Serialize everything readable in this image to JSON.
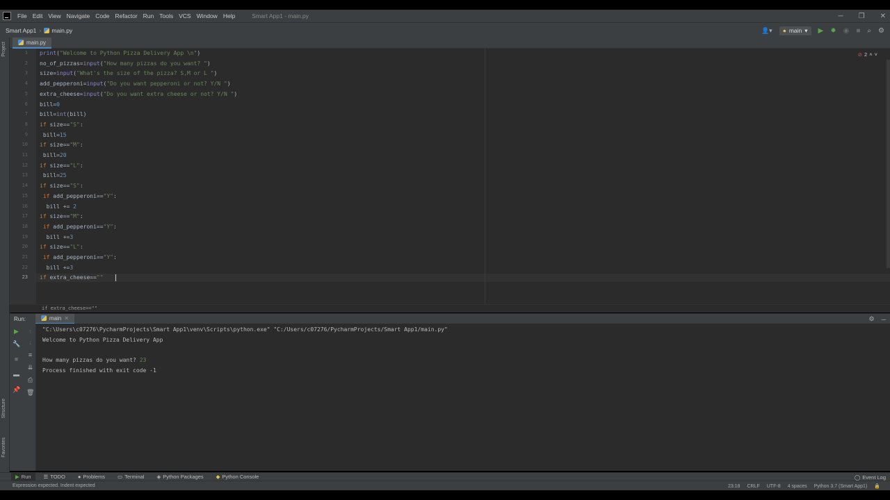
{
  "menu": {
    "items": [
      "File",
      "Edit",
      "View",
      "Navigate",
      "Code",
      "Refactor",
      "Run",
      "Tools",
      "VCS",
      "Window",
      "Help"
    ],
    "window_title": "Smart App1 - main.py"
  },
  "window_controls": {
    "minimize": "─",
    "restore": "❐",
    "close": "✕"
  },
  "navbar": {
    "project": "Smart App1",
    "file": "main.py",
    "run_config": "main"
  },
  "left_strip": {
    "project_label": "Project",
    "structure_label": "Structure",
    "favorites_label": "Favorites"
  },
  "editor": {
    "tab_label": "main.py",
    "error_count": "2",
    "current_line": "23",
    "line_numbers": [
      "1",
      "2",
      "3",
      "4",
      "5",
      "6",
      "7",
      "8",
      "9",
      "10",
      "11",
      "12",
      "13",
      "14",
      "15",
      "16",
      "17",
      "18",
      "19",
      "20",
      "21",
      "22",
      "23"
    ],
    "lines": [
      "print(\"Welcome to Python Pizza Delivery App \\n\")",
      "no_of_pizzas=input(\"How many pizzas do you want? \")",
      "size=input(\"What's the size of the pizza? S,M or L \")",
      "add_pepperoni=input(\"Do you want pepperoni or not? Y/N \")",
      "extra_cheese=input(\"Do you want extra cheese or not? Y/N \")",
      "bill=0",
      "bill=int(bill)",
      "if size==\"S\":",
      " bill=15",
      "if size==\"M\":",
      " bill=20",
      "if size==\"L\":",
      " bill=25",
      "if size==\"S\":",
      " if add_pepperoni==\"Y\":",
      "  bill += 2",
      "if size==\"M\":",
      " if add_pepperoni==\"Y\":",
      "  bill +=3",
      "if size==\"L\":",
      " if add_pepperoni==\"Y\":",
      "  bill +=3",
      "if extra_cheese==\"\""
    ],
    "breadcrumb": "if extra_cheese==\"\""
  },
  "run": {
    "title": "Run:",
    "tab": "main",
    "console": [
      "\"C:\\Users\\c07276\\PycharmProjects\\Smart App1\\venv\\Scripts\\python.exe\" \"C:/Users/c07276/PycharmProjects/Smart App1/main.py\"",
      "Welcome to Python Pizza Delivery App",
      "",
      "How many pizzas do you want? ",
      "Process finished with exit code -1"
    ],
    "user_input": "23"
  },
  "toolbar_bottom": {
    "run": "Run",
    "todo": "TODO",
    "problems": "Problems",
    "terminal": "Terminal",
    "python_packages": "Python Packages",
    "python_console": "Python Console",
    "event_log": "Event Log"
  },
  "status": {
    "message": "Expression expected. Indent expected",
    "position": "23:18",
    "line_sep": "CRLF",
    "encoding": "UTF-8",
    "indent": "4 spaces",
    "interpreter": "Python 3.7 (Smart App1)"
  },
  "colors": {
    "chrome": "#3c3f41",
    "editor_bg": "#2b2b2b",
    "string": "#6a8759",
    "keyword": "#cc7832",
    "run_green": "#5aa54b",
    "error": "#c75450"
  }
}
